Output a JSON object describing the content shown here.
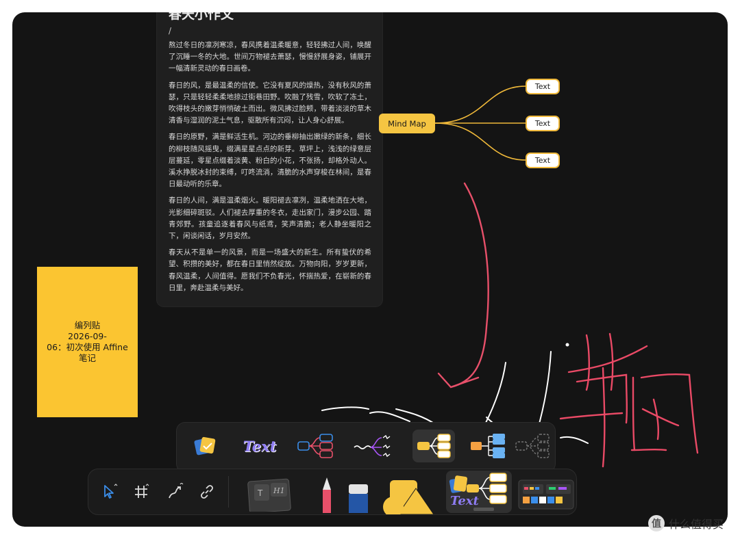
{
  "document": {
    "title": "春天小作文",
    "slash": "/",
    "paragraphs": [
      "熬过冬日的凛冽寒凉，春风携着温柔暖意，轻轻拂过人间，唤醒了沉睡一冬的大地。世间万物褪去萧瑟，慢慢舒展身姿，铺展开一幅清新灵动的春日画卷。",
      "春日的风，是最温柔的信使。它没有夏风的燥热，没有秋风的萧瑟，只是轻轻柔柔地掠过街巷田野。吹融了残雪，吹软了冻土，吹得枝头的嫩芽悄悄破土而出。微风拂过脸颊，带着淡淡的草木清香与湿润的泥土气息，驱散所有沉闷，让人身心舒展。",
      "春日的原野，满是鲜活生机。河边的垂柳抽出嫩绿的新条，细长的柳枝随风摇曳，缀满星星点点的新芽。草坪上，浅浅的绿意层层蔓延，零星点缀着淡黄、粉白的小花，不张扬，却格外动人。溪水挣脱冰封的束缚，叮咚流淌，清脆的水声穿梭在林间，是春日最动听的乐章。",
      "春日的人间，满是温柔烟火。暖阳褪去凛冽，温柔地洒在大地，光影细碎斑驳。人们褪去厚重的冬衣，走出家门，漫步公园、踏青郊野。孩童追逐着春风与纸鸢，笑声清脆；老人静坐暖阳之下，闲谈闲话，岁月安然。",
      "春天从不是单一的风景，而是一场盛大的新生。所有蛰伏的希望、积攒的美好，都在春日里悄然绽放。万物向阳，岁岁更新，春风温柔，人间值得。愿我们不负春光，怀揣热爱，在崭新的春日里，奔赴温柔与美好。"
    ]
  },
  "sticky_note": {
    "lines": [
      "编列贴",
      "2026-09-",
      "06：初次使用 Affine",
      "笔记"
    ]
  },
  "mind_map": {
    "root": "Mind Map",
    "children": [
      "Text",
      "Text",
      "Text"
    ],
    "connector_color": "#f0b93a"
  },
  "scribble": {
    "arrow_color": "#e8506a",
    "ink_color": "#ffffff",
    "red_ink_color": "#ea4a66"
  },
  "mindmap_style_panel": {
    "items": [
      {
        "name": "sticker-style",
        "icon": "sticker-icon"
      },
      {
        "name": "text-style",
        "label": "Text"
      },
      {
        "name": "blue-outline-style",
        "icon": "mindmap-outline-icon"
      },
      {
        "name": "handdrawn-style",
        "icon": "mindmap-handdrawn-icon"
      },
      {
        "name": "yellow-style",
        "icon": "mindmap-yellow-icon",
        "selected": true
      },
      {
        "name": "blue-tree-style",
        "icon": "mindmap-tree-icon"
      },
      {
        "name": "dashed-style",
        "icon": "mindmap-dashed-icon"
      }
    ]
  },
  "main_toolbar": {
    "tools": [
      {
        "name": "select",
        "icon": "cursor-icon",
        "active": true
      },
      {
        "name": "frame",
        "icon": "frame-icon"
      },
      {
        "name": "connector",
        "icon": "connector-icon"
      },
      {
        "name": "link",
        "icon": "link-icon"
      }
    ],
    "note_card_label": "H1",
    "text_card_label": "T",
    "mindmap_label": "Text",
    "accent_color": "#3b8eea"
  },
  "watermark": {
    "logo": "值",
    "text": "什么值得买"
  }
}
